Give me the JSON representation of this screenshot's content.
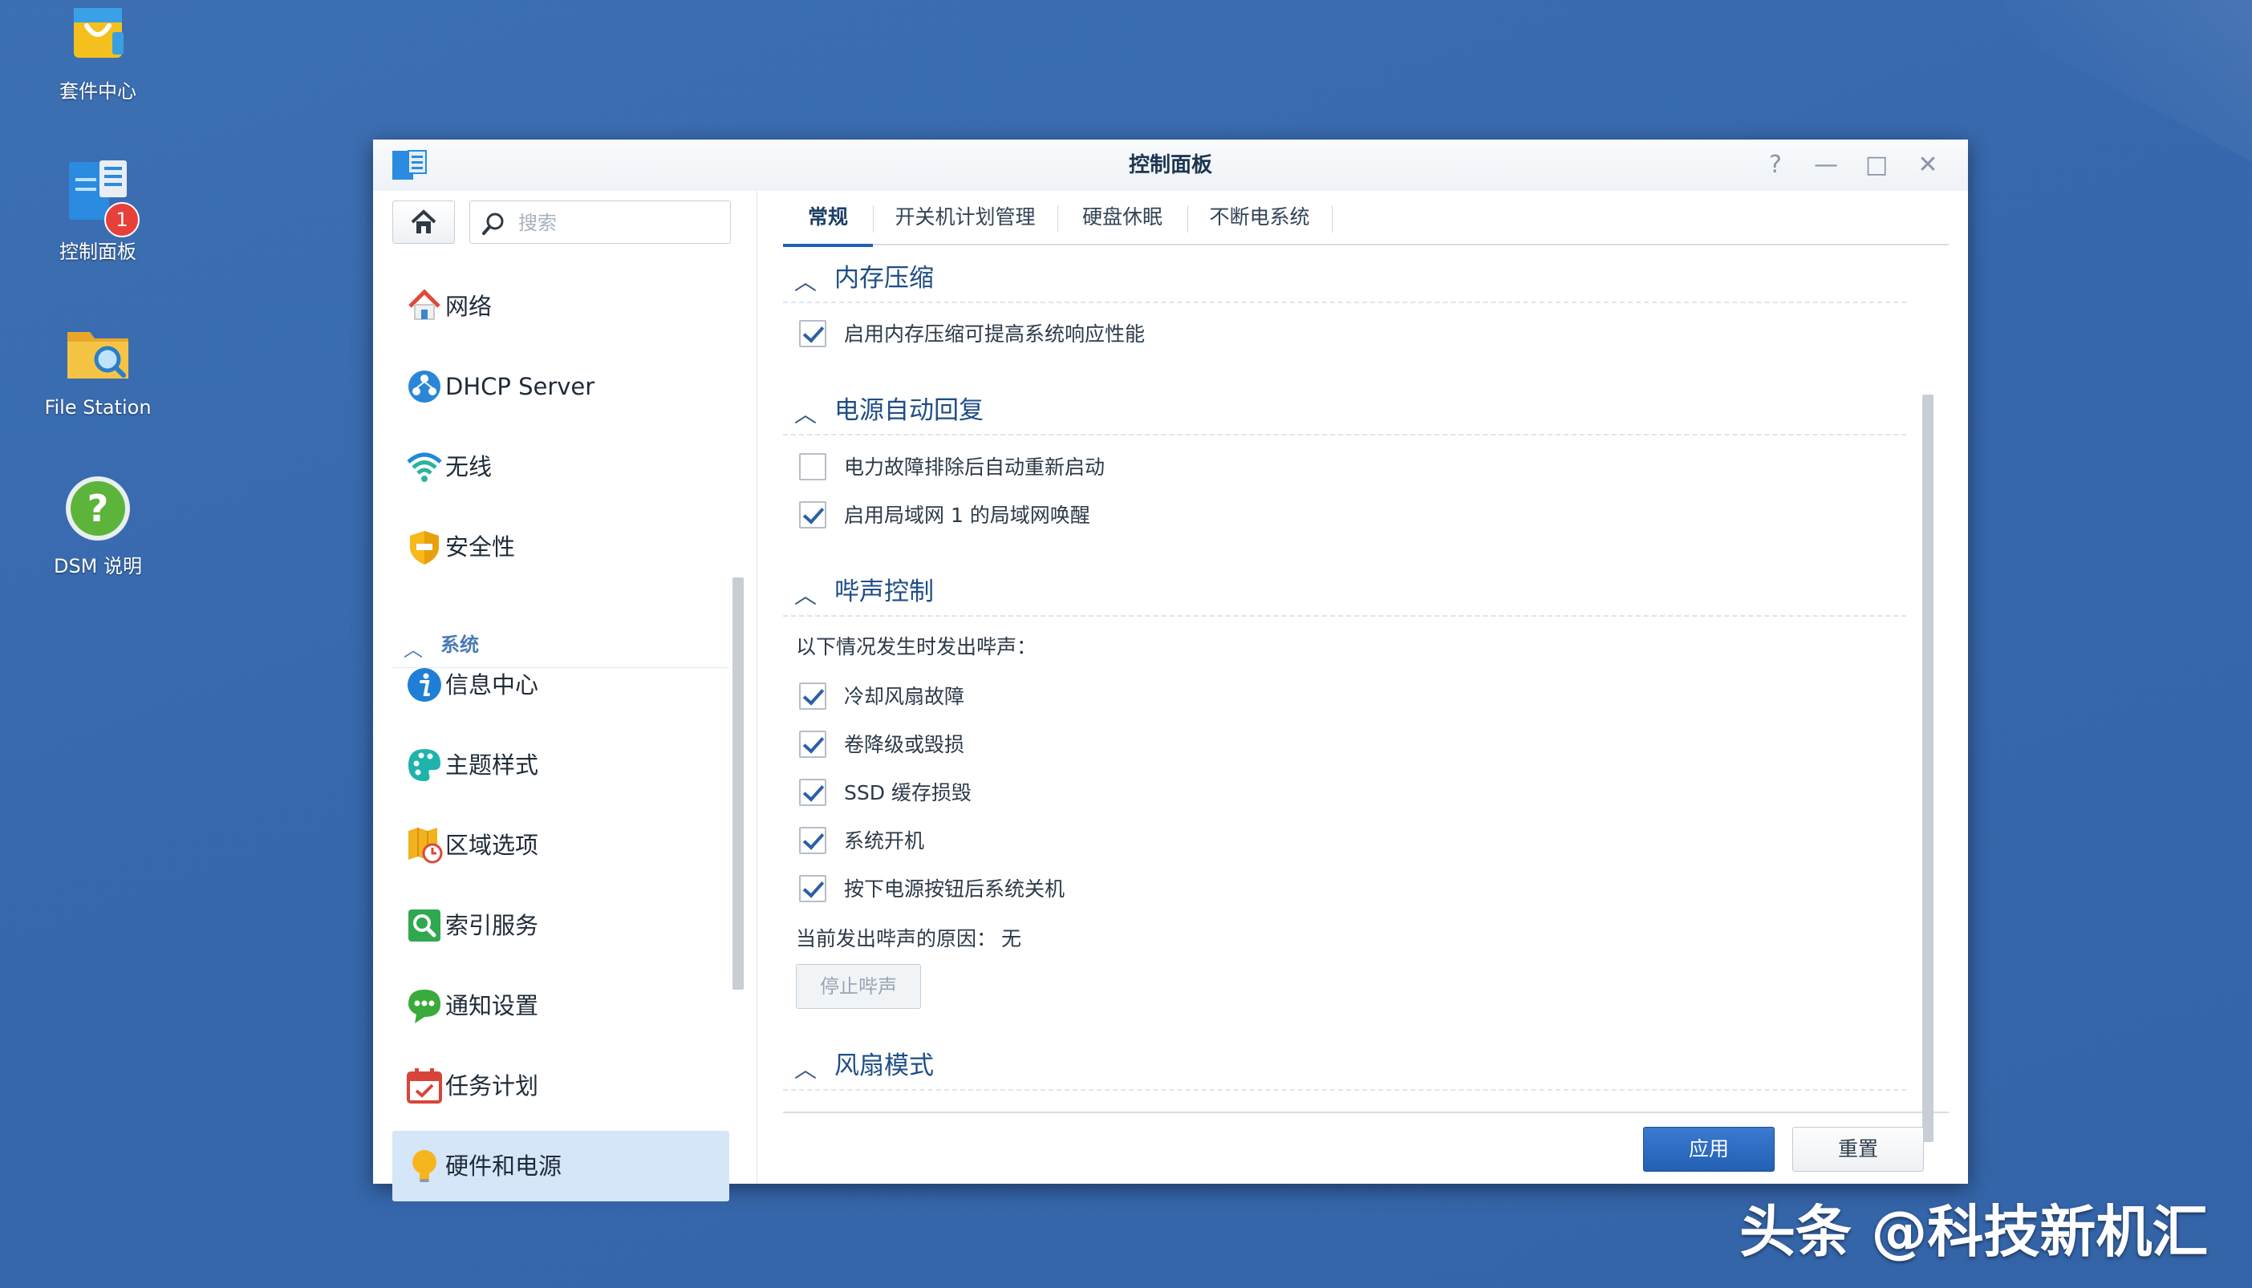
{
  "desktop": {
    "icons": [
      {
        "label": "套件中心"
      },
      {
        "label": "控制面板",
        "badge": "1"
      },
      {
        "label": "File Station"
      },
      {
        "label": "DSM 说明"
      }
    ]
  },
  "window": {
    "title": "控制面板",
    "controls": {
      "help": "?",
      "minimize": "—",
      "maximize": "□",
      "close": "✕"
    }
  },
  "sidebar": {
    "search_placeholder": "搜索",
    "items": [
      {
        "label": "网络",
        "icon": "network-icon"
      },
      {
        "label": "DHCP Server",
        "icon": "dhcp-icon"
      },
      {
        "label": "无线",
        "icon": "wifi-icon"
      },
      {
        "label": "安全性",
        "icon": "shield-icon"
      }
    ],
    "section": "系统",
    "system_items": [
      {
        "label": "信息中心",
        "icon": "info-icon"
      },
      {
        "label": "主题样式",
        "icon": "palette-icon"
      },
      {
        "label": "区域选项",
        "icon": "regional-icon"
      },
      {
        "label": "索引服务",
        "icon": "index-icon"
      },
      {
        "label": "通知设置",
        "icon": "notification-icon"
      },
      {
        "label": "任务计划",
        "icon": "calendar-icon"
      },
      {
        "label": "硬件和电源",
        "icon": "bulb-icon",
        "active": true
      }
    ]
  },
  "tabs": [
    {
      "label": "常规",
      "active": true
    },
    {
      "label": "开关机计划管理"
    },
    {
      "label": "硬盘休眠"
    },
    {
      "label": "不断电系统"
    }
  ],
  "groups": {
    "memory": {
      "title": "内存压缩",
      "options": [
        {
          "label": "启用内存压缩可提高系统响应性能",
          "checked": true
        }
      ]
    },
    "power": {
      "title": "电源自动回复",
      "options": [
        {
          "label": "电力故障排除后自动重新启动",
          "checked": false
        },
        {
          "label": "启用局域网 1 的局域网唤醒",
          "checked": true
        }
      ]
    },
    "beep": {
      "title": "哔声控制",
      "intro": "以下情况发生时发出哔声：",
      "options": [
        {
          "label": "冷却风扇故障",
          "checked": true
        },
        {
          "label": "卷降级或毁损",
          "checked": true
        },
        {
          "label": "SSD 缓存损毁",
          "checked": true
        },
        {
          "label": "系统开机",
          "checked": true
        },
        {
          "label": "按下电源按钮后系统关机",
          "checked": true
        }
      ],
      "reason_label": "当前发出哔声的原因：",
      "reason_value": "无",
      "stop_button": "停止哔声"
    },
    "fan": {
      "title": "风扇模式"
    }
  },
  "footer": {
    "apply": "应用",
    "reset": "重置"
  },
  "watermark": "头条 @科技新机汇",
  "colors": {
    "accent": "#1f62b8",
    "desktop": "#3768ad",
    "active_item": "#d5e6f8"
  }
}
